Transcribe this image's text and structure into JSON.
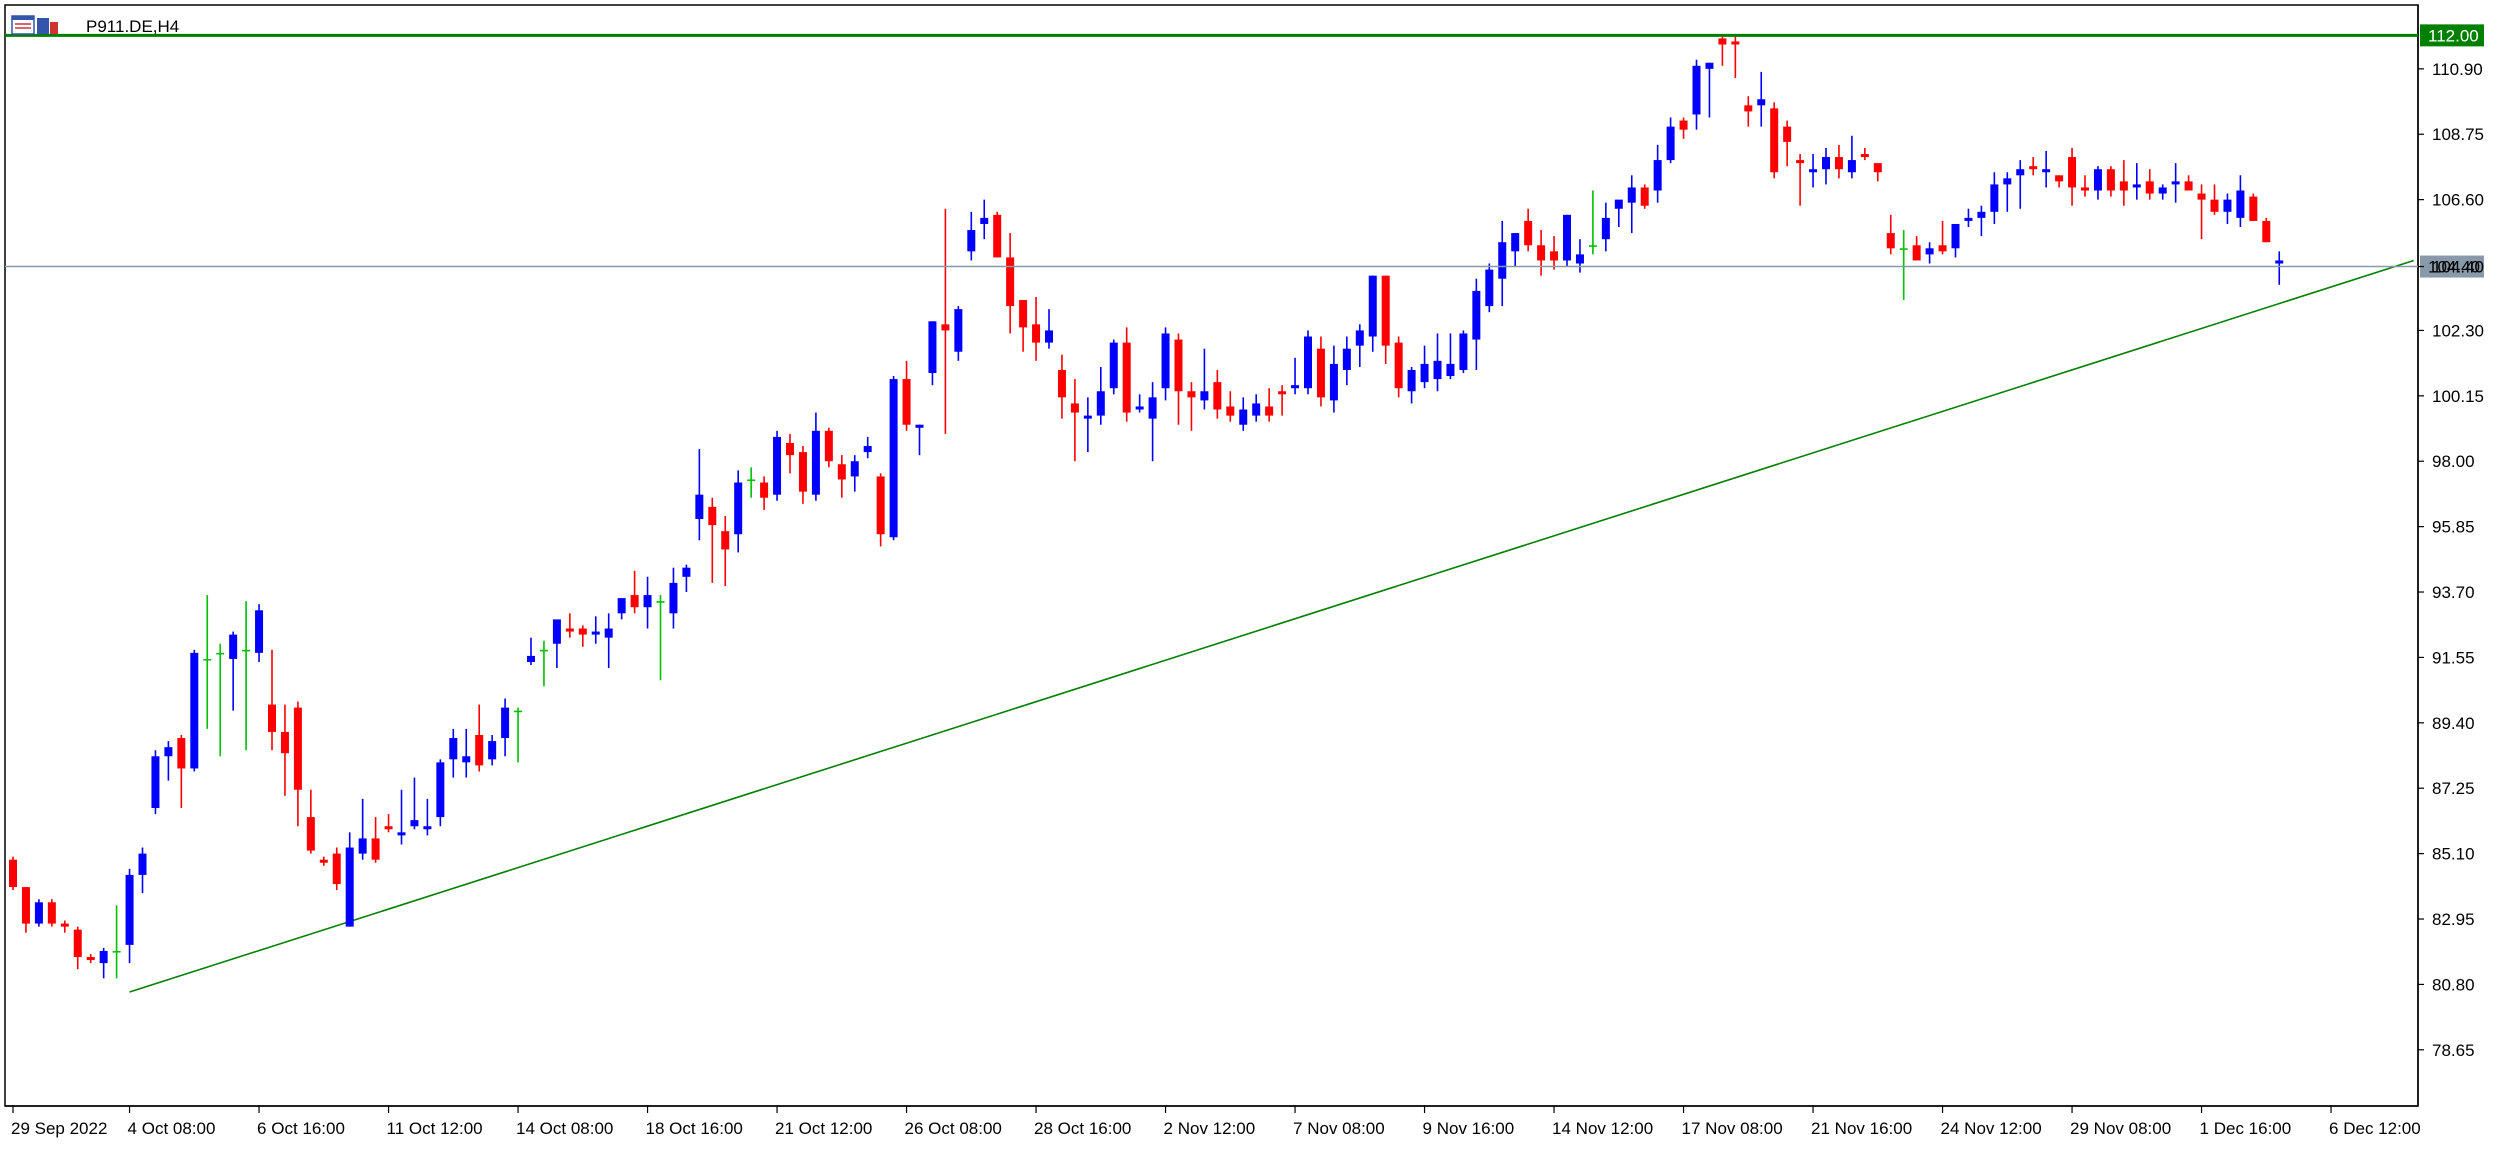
{
  "window": {
    "symbol_label": "P911.DE,H4",
    "icon": "chart-window-icon"
  },
  "colors": {
    "bull": "#0000ff",
    "bear": "#ff0000",
    "doji": "#00c000",
    "trendline": "#008000",
    "resistance": "#008000",
    "current_price_line": "#8899aa",
    "resistance_label_bg": "#008000",
    "price_label_bg": "#8899aa"
  },
  "chart_data": {
    "type": "candlestick",
    "title": "P911.DE,H4",
    "ylim": [
      77.0,
      112.9
    ],
    "y_ticks": [
      "110.90",
      "108.75",
      "106.60",
      "104.40",
      "102.30",
      "100.15",
      "98.00",
      "95.85",
      "93.70",
      "91.55",
      "89.40",
      "87.25",
      "85.10",
      "82.95",
      "80.80",
      "78.65"
    ],
    "x_ticks": [
      "29 Sep 2022",
      "4 Oct 08:00",
      "6 Oct 16:00",
      "11 Oct 12:00",
      "14 Oct 08:00",
      "18 Oct 16:00",
      "21 Oct 12:00",
      "26 Oct 08:00",
      "28 Oct 16:00",
      "2 Nov 12:00",
      "7 Nov 08:00",
      "9 Nov 16:00",
      "14 Nov 12:00",
      "17 Nov 08:00",
      "21 Nov 16:00",
      "24 Nov 12:00",
      "29 Nov 08:00",
      "1 Dec 16:00",
      "6 Dec 12:00"
    ],
    "x_tick_bars": [
      0,
      9,
      19,
      29,
      39,
      49,
      59,
      69,
      79,
      89,
      99,
      109,
      119,
      129,
      139,
      149,
      159,
      169,
      179
    ],
    "ohlc": [
      [
        84.9,
        85.0,
        83.9,
        84.0
      ],
      [
        84.0,
        84.0,
        82.5,
        82.8
      ],
      [
        82.8,
        83.6,
        82.7,
        83.5
      ],
      [
        83.5,
        83.6,
        82.7,
        82.8
      ],
      [
        82.8,
        82.9,
        82.5,
        82.7
      ],
      [
        82.6,
        82.7,
        81.3,
        81.7
      ],
      [
        81.7,
        81.8,
        81.5,
        81.6
      ],
      [
        81.5,
        82.0,
        81.0,
        81.9
      ],
      [
        81.9,
        83.4,
        81.0,
        81.9
      ],
      [
        82.1,
        84.6,
        81.5,
        84.4
      ],
      [
        84.4,
        85.3,
        83.8,
        85.1
      ],
      [
        86.6,
        88.5,
        86.4,
        88.3
      ],
      [
        88.3,
        88.8,
        87.5,
        88.6
      ],
      [
        88.9,
        89.0,
        86.6,
        87.9
      ],
      [
        87.9,
        91.8,
        87.8,
        91.7
      ],
      [
        91.5,
        93.6,
        89.2,
        91.5
      ],
      [
        91.7,
        92.0,
        88.3,
        91.7
      ],
      [
        91.5,
        92.4,
        89.8,
        92.3
      ],
      [
        91.8,
        93.4,
        88.5,
        91.8
      ],
      [
        91.7,
        93.3,
        91.4,
        93.1
      ],
      [
        90.0,
        91.8,
        88.5,
        89.1
      ],
      [
        89.1,
        90.0,
        87.0,
        88.4
      ],
      [
        89.9,
        90.1,
        86.0,
        87.2
      ],
      [
        86.3,
        87.2,
        85.1,
        85.2
      ],
      [
        84.9,
        85.0,
        84.7,
        84.8
      ],
      [
        85.1,
        85.3,
        83.9,
        84.1
      ],
      [
        82.7,
        85.8,
        82.7,
        85.3
      ],
      [
        85.1,
        86.9,
        84.9,
        85.6
      ],
      [
        85.6,
        86.3,
        84.8,
        84.9
      ],
      [
        86.0,
        86.4,
        85.8,
        85.9
      ],
      [
        85.7,
        87.2,
        85.4,
        85.8
      ],
      [
        86.0,
        87.6,
        85.9,
        86.2
      ],
      [
        85.9,
        86.9,
        85.7,
        86.0
      ],
      [
        86.3,
        88.2,
        86.0,
        88.1
      ],
      [
        88.2,
        89.2,
        87.6,
        88.9
      ],
      [
        88.1,
        89.2,
        87.6,
        88.3
      ],
      [
        89.0,
        90.0,
        87.8,
        88.0
      ],
      [
        88.2,
        89.0,
        88.0,
        88.8
      ],
      [
        88.9,
        90.2,
        88.3,
        89.9
      ],
      [
        89.8,
        89.9,
        88.1,
        89.8
      ],
      [
        91.4,
        92.2,
        91.3,
        91.6
      ],
      [
        91.8,
        92.1,
        90.6,
        91.8
      ],
      [
        92.0,
        92.7,
        91.2,
        92.8
      ],
      [
        92.5,
        93.0,
        92.2,
        92.4
      ],
      [
        92.5,
        92.6,
        91.9,
        92.3
      ],
      [
        92.3,
        92.9,
        92.0,
        92.4
      ],
      [
        92.2,
        93.0,
        91.2,
        92.5
      ],
      [
        93.0,
        93.4,
        92.8,
        93.5
      ],
      [
        93.6,
        94.4,
        93.0,
        93.2
      ],
      [
        93.2,
        94.2,
        92.5,
        93.6
      ],
      [
        93.4,
        93.6,
        90.8,
        93.4
      ],
      [
        93.0,
        94.5,
        92.5,
        94.0
      ],
      [
        94.2,
        94.6,
        93.7,
        94.5
      ],
      [
        96.1,
        98.4,
        95.4,
        96.9
      ],
      [
        96.5,
        96.8,
        94.0,
        95.9
      ],
      [
        95.7,
        96.2,
        93.9,
        95.1
      ],
      [
        95.6,
        97.7,
        95.0,
        97.3
      ],
      [
        97.4,
        97.8,
        96.8,
        97.4
      ],
      [
        97.3,
        97.5,
        96.4,
        96.8
      ],
      [
        96.9,
        99.0,
        96.7,
        98.8
      ],
      [
        98.6,
        98.9,
        97.6,
        98.2
      ],
      [
        98.3,
        98.5,
        96.6,
        97.0
      ],
      [
        96.9,
        99.6,
        96.7,
        99.0
      ],
      [
        99.0,
        99.1,
        97.8,
        98.0
      ],
      [
        97.9,
        98.2,
        96.8,
        97.4
      ],
      [
        97.5,
        98.2,
        97.0,
        98.0
      ],
      [
        98.3,
        98.8,
        98.1,
        98.5
      ],
      [
        97.5,
        97.6,
        95.2,
        95.6
      ],
      [
        95.5,
        100.8,
        95.4,
        100.7
      ],
      [
        100.7,
        101.3,
        99.0,
        99.2
      ],
      [
        99.1,
        99.2,
        98.2,
        99.2
      ],
      [
        100.9,
        102.6,
        100.5,
        102.6
      ],
      [
        102.5,
        106.3,
        98.9,
        102.3
      ],
      [
        101.6,
        103.1,
        101.3,
        103.0
      ],
      [
        104.9,
        106.2,
        104.6,
        105.6
      ],
      [
        105.8,
        106.6,
        105.3,
        106.0
      ],
      [
        106.1,
        106.2,
        104.7,
        104.7
      ],
      [
        104.7,
        105.5,
        102.2,
        103.1
      ],
      [
        103.3,
        103.3,
        101.6,
        102.4
      ],
      [
        102.5,
        103.4,
        101.3,
        101.9
      ],
      [
        101.9,
        103.0,
        101.7,
        102.3
      ],
      [
        101.0,
        101.5,
        99.4,
        100.1
      ],
      [
        99.9,
        100.7,
        98.0,
        99.6
      ],
      [
        99.4,
        100.1,
        98.3,
        99.5
      ],
      [
        99.5,
        101.1,
        99.2,
        100.3
      ],
      [
        100.4,
        102.0,
        100.2,
        101.9
      ],
      [
        101.9,
        102.4,
        99.3,
        99.6
      ],
      [
        99.7,
        100.2,
        99.6,
        99.8
      ],
      [
        99.4,
        100.6,
        98.0,
        100.1
      ],
      [
        100.4,
        102.4,
        100.0,
        102.2
      ],
      [
        102.0,
        102.2,
        99.2,
        100.3
      ],
      [
        100.3,
        100.6,
        99.0,
        100.1
      ],
      [
        100.0,
        101.7,
        99.7,
        100.3
      ],
      [
        100.6,
        101.0,
        99.4,
        99.7
      ],
      [
        99.8,
        100.3,
        99.3,
        99.5
      ],
      [
        99.2,
        100.1,
        99.0,
        99.7
      ],
      [
        99.5,
        100.2,
        99.3,
        99.9
      ],
      [
        99.8,
        100.4,
        99.3,
        99.5
      ],
      [
        100.3,
        100.5,
        99.5,
        100.2
      ],
      [
        100.4,
        101.4,
        100.2,
        100.5
      ],
      [
        100.4,
        102.3,
        100.2,
        102.1
      ],
      [
        101.7,
        102.1,
        99.8,
        100.1
      ],
      [
        100.0,
        101.8,
        99.6,
        101.2
      ],
      [
        101.0,
        102.1,
        100.5,
        101.7
      ],
      [
        101.8,
        102.5,
        101.1,
        102.3
      ],
      [
        102.1,
        104.1,
        101.6,
        104.1
      ],
      [
        104.1,
        104.1,
        101.2,
        101.8
      ],
      [
        101.9,
        102.1,
        100.1,
        100.4
      ],
      [
        100.3,
        101.1,
        99.9,
        101.0
      ],
      [
        100.6,
        101.8,
        100.4,
        101.2
      ],
      [
        100.7,
        102.2,
        100.3,
        101.3
      ],
      [
        100.8,
        102.2,
        100.7,
        101.2
      ],
      [
        101.0,
        102.3,
        100.9,
        102.2
      ],
      [
        102.0,
        104.0,
        101.0,
        103.6
      ],
      [
        103.1,
        104.5,
        102.9,
        104.3
      ],
      [
        104.0,
        105.9,
        103.1,
        105.2
      ],
      [
        104.9,
        105.5,
        104.4,
        105.5
      ],
      [
        105.9,
        106.3,
        104.9,
        105.1
      ],
      [
        105.1,
        105.6,
        104.1,
        104.6
      ],
      [
        104.9,
        105.4,
        104.3,
        104.6
      ],
      [
        104.6,
        106.1,
        104.4,
        106.1
      ],
      [
        104.5,
        105.3,
        104.2,
        104.8
      ],
      [
        105.1,
        106.9,
        104.8,
        105.1
      ],
      [
        105.3,
        106.5,
        104.9,
        106.0
      ],
      [
        106.3,
        106.5,
        105.7,
        106.6
      ],
      [
        106.5,
        107.4,
        105.5,
        107.0
      ],
      [
        107.0,
        107.1,
        106.3,
        106.4
      ],
      [
        106.9,
        108.4,
        106.5,
        107.9
      ],
      [
        107.9,
        109.3,
        107.8,
        109.0
      ],
      [
        109.2,
        109.3,
        108.6,
        108.9
      ],
      [
        109.4,
        111.2,
        108.9,
        111.0
      ],
      [
        110.9,
        111.1,
        109.3,
        111.1
      ],
      [
        111.9,
        112.0,
        111.0,
        111.7
      ],
      [
        111.8,
        112.0,
        110.6,
        111.7
      ],
      [
        109.7,
        110.0,
        109.0,
        109.5
      ],
      [
        109.7,
        110.8,
        109.0,
        109.9
      ],
      [
        109.6,
        109.8,
        107.3,
        107.5
      ],
      [
        109.0,
        109.2,
        107.7,
        108.5
      ],
      [
        107.9,
        108.1,
        106.4,
        107.8
      ],
      [
        107.5,
        108.1,
        107.0,
        107.6
      ],
      [
        107.6,
        108.3,
        107.1,
        108.0
      ],
      [
        108.0,
        108.4,
        107.3,
        107.6
      ],
      [
        107.5,
        108.7,
        107.3,
        107.9
      ],
      [
        108.1,
        108.3,
        107.9,
        108.0
      ],
      [
        107.8,
        107.8,
        107.2,
        107.5
      ],
      [
        105.5,
        106.1,
        104.8,
        105.0
      ],
      [
        105.0,
        105.6,
        103.3,
        105.0
      ],
      [
        105.1,
        105.4,
        104.7,
        104.6
      ],
      [
        104.8,
        105.2,
        104.5,
        105.0
      ],
      [
        105.1,
        105.9,
        104.8,
        104.9
      ],
      [
        105.0,
        105.6,
        104.7,
        105.8
      ],
      [
        105.9,
        106.3,
        105.7,
        106.0
      ],
      [
        106.0,
        106.4,
        105.4,
        106.2
      ],
      [
        106.2,
        107.5,
        105.8,
        107.1
      ],
      [
        107.1,
        107.5,
        106.2,
        107.3
      ],
      [
        107.4,
        107.9,
        106.3,
        107.6
      ],
      [
        107.7,
        108.0,
        107.4,
        107.6
      ],
      [
        107.5,
        108.2,
        107.0,
        107.6
      ],
      [
        107.4,
        107.4,
        107.0,
        107.2
      ],
      [
        108.0,
        108.3,
        106.4,
        107.0
      ],
      [
        107.0,
        107.4,
        106.7,
        106.9
      ],
      [
        106.9,
        107.7,
        106.6,
        107.6
      ],
      [
        107.6,
        107.7,
        106.7,
        106.9
      ],
      [
        107.2,
        107.9,
        106.4,
        106.9
      ],
      [
        107.0,
        107.8,
        106.6,
        107.1
      ],
      [
        107.2,
        107.6,
        106.6,
        106.8
      ],
      [
        106.8,
        107.1,
        106.6,
        107.0
      ],
      [
        107.1,
        107.8,
        106.5,
        107.2
      ],
      [
        107.2,
        107.4,
        106.9,
        106.9
      ],
      [
        106.8,
        107.1,
        105.3,
        106.6
      ],
      [
        106.6,
        107.1,
        106.1,
        106.2
      ],
      [
        106.2,
        106.8,
        105.8,
        106.6
      ],
      [
        106.0,
        107.4,
        105.7,
        106.9
      ],
      [
        106.7,
        106.8,
        105.9,
        105.9
      ],
      [
        105.9,
        106.0,
        105.2,
        105.2
      ],
      [
        104.5,
        104.9,
        103.8,
        104.6
      ]
    ],
    "series_colors": {
      "up": "#0000ff",
      "down": "#ff0000"
    },
    "resistance_level": {
      "value": 112.0,
      "label": "112.00"
    },
    "current_price": {
      "value": 104.4,
      "label": "104.40"
    },
    "trendline": {
      "from_bar": 9,
      "from_price": 80.55,
      "to_bar": 185,
      "to_price": 104.6
    }
  }
}
